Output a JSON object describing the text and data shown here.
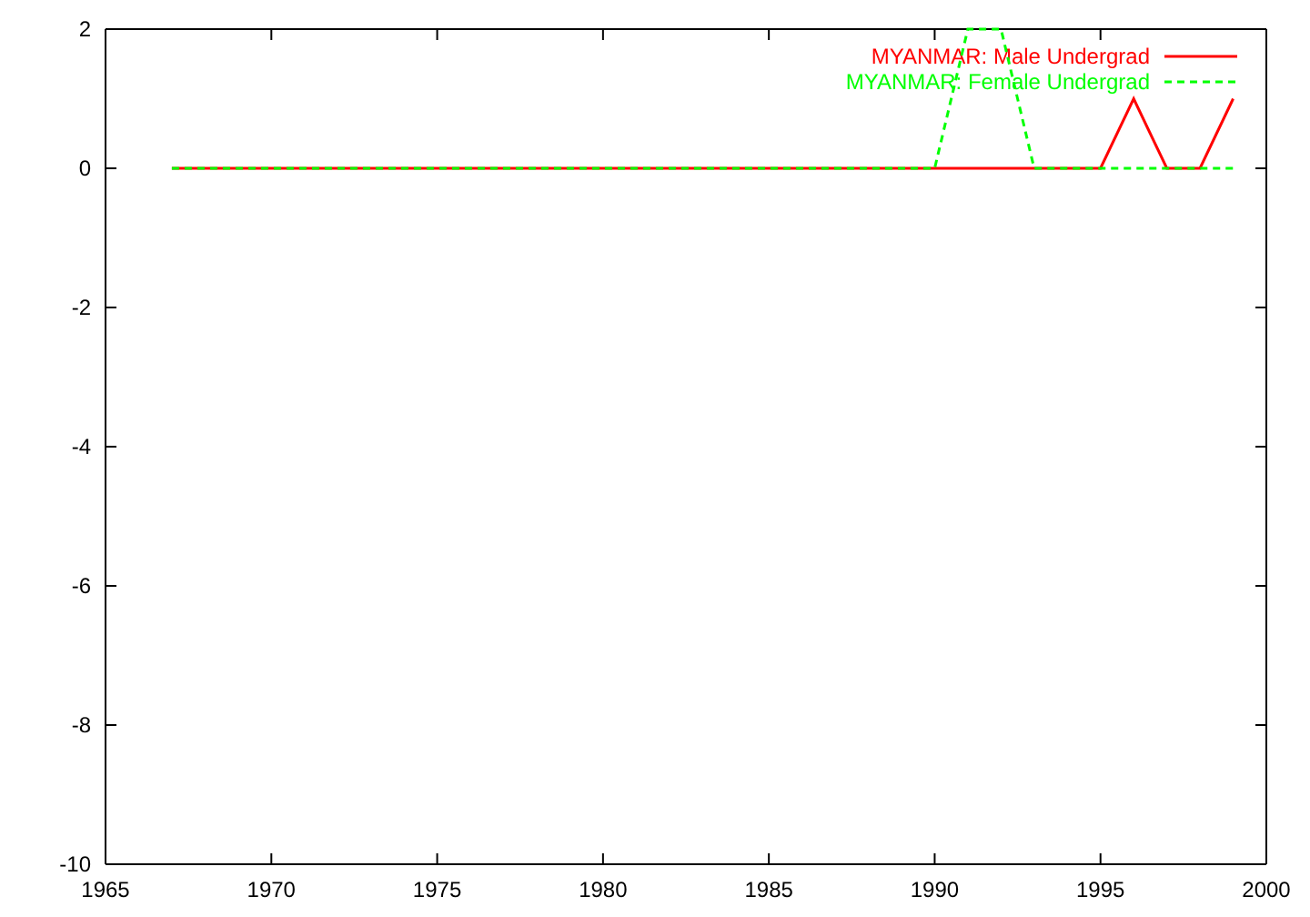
{
  "chart_data": {
    "type": "line",
    "x": [
      1967,
      1968,
      1969,
      1970,
      1971,
      1972,
      1973,
      1974,
      1975,
      1976,
      1977,
      1978,
      1979,
      1980,
      1981,
      1982,
      1983,
      1984,
      1985,
      1986,
      1987,
      1988,
      1989,
      1990,
      1991,
      1992,
      1993,
      1994,
      1995,
      1996,
      1997,
      1998,
      1999
    ],
    "series": [
      {
        "name": "MYANMAR: Male Undergrad",
        "color": "#ff0000",
        "line_style": "solid",
        "values": [
          0,
          0,
          0,
          0,
          0,
          0,
          0,
          0,
          0,
          0,
          0,
          0,
          0,
          0,
          0,
          0,
          0,
          0,
          0,
          0,
          0,
          0,
          0,
          0,
          0,
          0,
          0,
          0,
          0,
          1,
          0,
          0,
          1
        ]
      },
      {
        "name": "MYANMAR: Female Undergrad",
        "color": "#00ff00",
        "line_style": "dashed",
        "values": [
          0,
          0,
          0,
          0,
          0,
          0,
          0,
          0,
          0,
          0,
          0,
          0,
          0,
          0,
          0,
          0,
          0,
          0,
          0,
          0,
          0,
          0,
          0,
          0,
          2,
          2,
          0,
          0,
          0,
          0,
          0,
          0,
          0
        ]
      }
    ],
    "legend": "upper right",
    "xlim": [
      1965,
      2000
    ],
    "ylim": [
      -10,
      2
    ],
    "xticks": [
      1965,
      1970,
      1975,
      1980,
      1985,
      1990,
      1995,
      2000
    ],
    "yticks": [
      -10,
      -8,
      -6,
      -4,
      -2,
      0,
      2
    ]
  }
}
